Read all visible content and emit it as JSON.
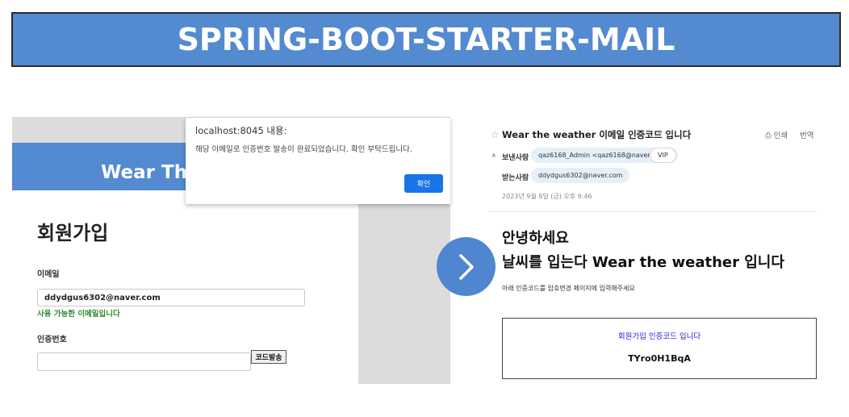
{
  "banner": {
    "title": "SPRING-BOOT-STARTER-MAIL",
    "bg_color": "#538ad0"
  },
  "signup_page": {
    "header_title": "Wear The",
    "page_title": "회원가입",
    "email_label": "이메일",
    "email_value": "ddydgus6302@naver.com",
    "email_status": "사용 가능한 이메일입니다",
    "code_label": "인증번호",
    "code_value": "",
    "send_code_button": "코드발송"
  },
  "alert_dialog": {
    "host": "localhost:8045 내용:",
    "message": "해당 이메일로 인증번호 발송이 완료되었습니다. 확인 부탁드립니다.",
    "ok_button": "확인",
    "button_color": "#1a73e8"
  },
  "arrow": {
    "icon": "chevron-right-icon",
    "color": "#4f86cf"
  },
  "email": {
    "subject": "Wear the weather 이메일 인증코드 입니다",
    "print_label": "인쇄",
    "translate_label": "번역",
    "from_label": "보낸사람",
    "from_value": "qaz6168_Admin <qaz6168@naver.com>",
    "vip_label": "VIP",
    "to_label": "받는사람",
    "to_value": "ddydgus6302@naver.com",
    "date": "2023년 9월 8일 (금) 오후 9:46",
    "greeting_line1": "안녕하세요",
    "greeting_line2": "날씨를 입는다 Wear the weather 입니다",
    "guide": "아래 인증코드를 암호변경 페이지에 입력해주세요",
    "code_box_title": "회원가입 인증코드 입니다",
    "code_value": "TYro0H1BqA"
  }
}
